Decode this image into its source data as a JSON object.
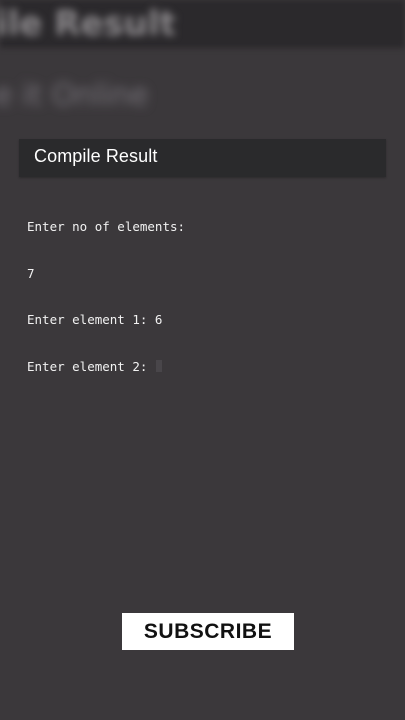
{
  "background": {
    "header_title": "ile Result",
    "subtitle": "e it Online"
  },
  "dialog": {
    "title": "Compile Result",
    "console_lines": [
      "Enter no of elements:",
      "7",
      "Enter element 1: 6",
      "Enter element 2: "
    ]
  },
  "overlay": {
    "subscribe_label": "SUBSCRIBE"
  },
  "colors": {
    "background": "#3b383b",
    "dialog_header": "#2a2a2c",
    "text": "#ffffff"
  }
}
